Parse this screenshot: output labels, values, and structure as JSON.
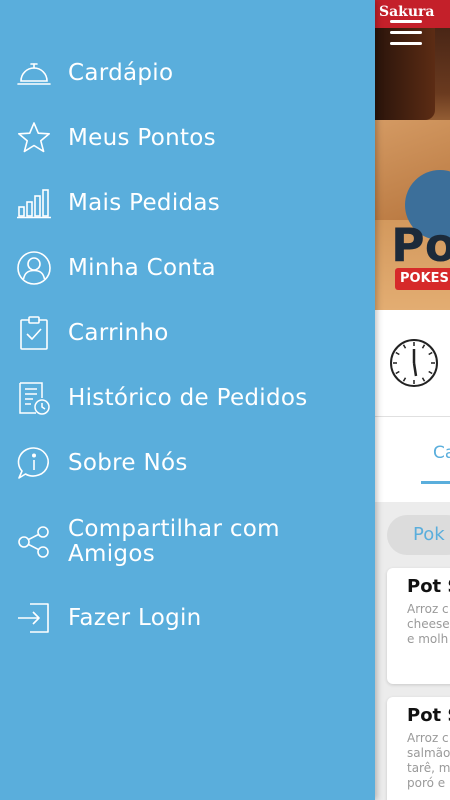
{
  "drawer": {
    "background": "#5aaedc",
    "items": [
      {
        "label": "Cardápio",
        "icon": "service-bell-icon"
      },
      {
        "label": "Meus Pontos",
        "icon": "star-icon"
      },
      {
        "label": "Mais Pedidas",
        "icon": "bar-chart-icon"
      },
      {
        "label": "Minha Conta",
        "icon": "user-circle-icon"
      },
      {
        "label": "Carrinho",
        "icon": "clipboard-check-icon"
      },
      {
        "label": "Histórico de Pedidos",
        "icon": "history-document-icon"
      },
      {
        "label": "Sobre Nós",
        "icon": "info-speech-icon"
      },
      {
        "label": "Compartilhar com Amigos",
        "icon": "share-icon"
      },
      {
        "label": "Fazer Login",
        "icon": "login-icon"
      }
    ]
  },
  "background": {
    "hero": {
      "sticker_text": "Sakura",
      "logo_text": "Po",
      "banner_text": "POKES"
    },
    "tab_label": "Ca",
    "chip_label": "Pok",
    "cards": [
      {
        "title": "Pot S",
        "desc": "Arroz c\ncheese\ne molh"
      },
      {
        "title": "Pot S",
        "desc": "Arroz c\nsalmão\ntarê, m\nporó e"
      }
    ]
  }
}
